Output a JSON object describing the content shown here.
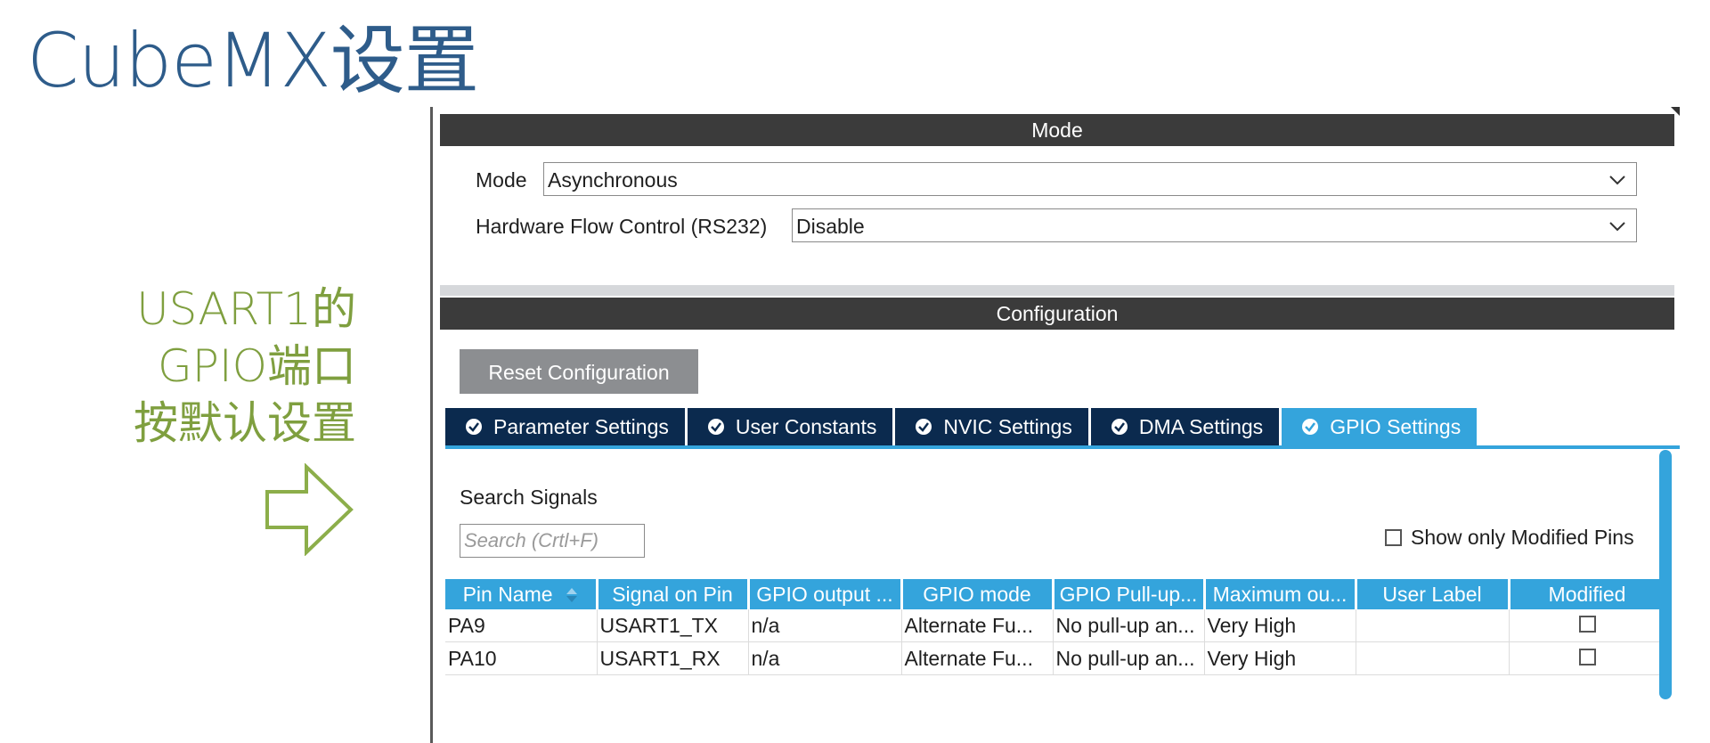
{
  "slide": {
    "title": "CubeMX设置",
    "annotation_lines": [
      "USART1的",
      "GPIO端口",
      "按默认设置"
    ],
    "arrow_icon": "right-arrow-outline-icon",
    "title_color": "#2e5c8a",
    "annotation_color": "#7f9f3f"
  },
  "mode_section": {
    "header": "Mode",
    "mode_label": "Mode",
    "mode_value": "Asynchronous",
    "flow_label": "Hardware Flow Control (RS232)",
    "flow_value": "Disable"
  },
  "config_section": {
    "header": "Configuration",
    "reset_label": "Reset Configuration",
    "tabs": [
      {
        "label": "Parameter Settings",
        "active": false
      },
      {
        "label": "User Constants",
        "active": false
      },
      {
        "label": "NVIC Settings",
        "active": false
      },
      {
        "label": "DMA Settings",
        "active": false
      },
      {
        "label": "GPIO Settings",
        "active": true
      }
    ],
    "search_label": "Search Signals",
    "search_placeholder": "Search (Crtl+F)",
    "show_modified_label": "Show only Modified Pins",
    "show_modified_checked": false,
    "table": {
      "columns": [
        "Pin Name",
        "Signal on Pin",
        "GPIO output ...",
        "GPIO mode",
        "GPIO Pull-up...",
        "Maximum ou...",
        "User Label",
        "Modified"
      ],
      "rows": [
        [
          "PA9",
          "USART1_TX",
          "n/a",
          "Alternate Fu...",
          "No pull-up an...",
          "Very High",
          "",
          false
        ],
        [
          "PA10",
          "USART1_RX",
          "n/a",
          "Alternate Fu...",
          "No pull-up an...",
          "Very High",
          "",
          false
        ]
      ]
    },
    "accent_color": "#34a4dc",
    "tab_color": "#0b2a4e",
    "header_color": "#3b3b3b"
  }
}
